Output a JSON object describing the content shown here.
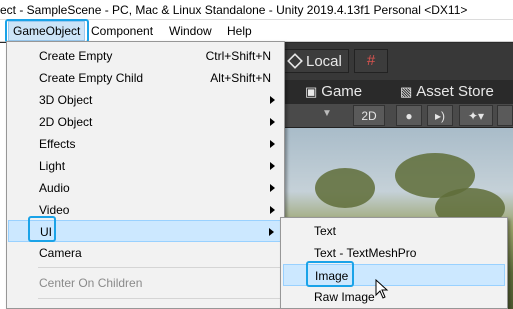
{
  "window": {
    "title": "ect - SampleScene - PC, Mac & Linux Standalone - Unity 2019.4.13f1 Personal <DX11>"
  },
  "menubar": {
    "items": [
      {
        "label": "GameObject",
        "active": true
      },
      {
        "label": "Component"
      },
      {
        "label": "Window"
      },
      {
        "label": "Help"
      }
    ]
  },
  "editor": {
    "local_label": "Local",
    "snap_icon": "grid-snap-icon",
    "tabs": [
      {
        "label": "Game",
        "icon": "gamepad-icon"
      },
      {
        "label": "Asset Store",
        "icon": "shopping-bag-icon"
      }
    ],
    "scene_toolbar": {
      "mode_2d": "2D",
      "lighting_icon": "lightbulb-icon",
      "audio_icon": "speaker-icon",
      "effects_icon": "effects-icon"
    }
  },
  "menu": {
    "items": [
      {
        "label": "Create Empty",
        "shortcut": "Ctrl+Shift+N"
      },
      {
        "label": "Create Empty Child",
        "shortcut": "Alt+Shift+N"
      },
      {
        "label": "3D Object",
        "submenu": true
      },
      {
        "label": "2D Object",
        "submenu": true
      },
      {
        "label": "Effects",
        "submenu": true
      },
      {
        "label": "Light",
        "submenu": true
      },
      {
        "label": "Audio",
        "submenu": true
      },
      {
        "label": "Video",
        "submenu": true
      },
      {
        "label": "UI",
        "submenu": true,
        "active": true
      },
      {
        "label": "Camera"
      },
      {
        "label": "Center On Children",
        "disabled": true
      }
    ]
  },
  "submenu": {
    "items": [
      {
        "label": "Text"
      },
      {
        "label": "Text - TextMeshPro"
      },
      {
        "label": "Image",
        "active": true
      },
      {
        "label": "Raw Image"
      }
    ]
  },
  "colors": {
    "highlight_border": "#1aa3e8",
    "menu_hover_bg": "#cce8ff",
    "snap_accent": "#d9534f"
  }
}
